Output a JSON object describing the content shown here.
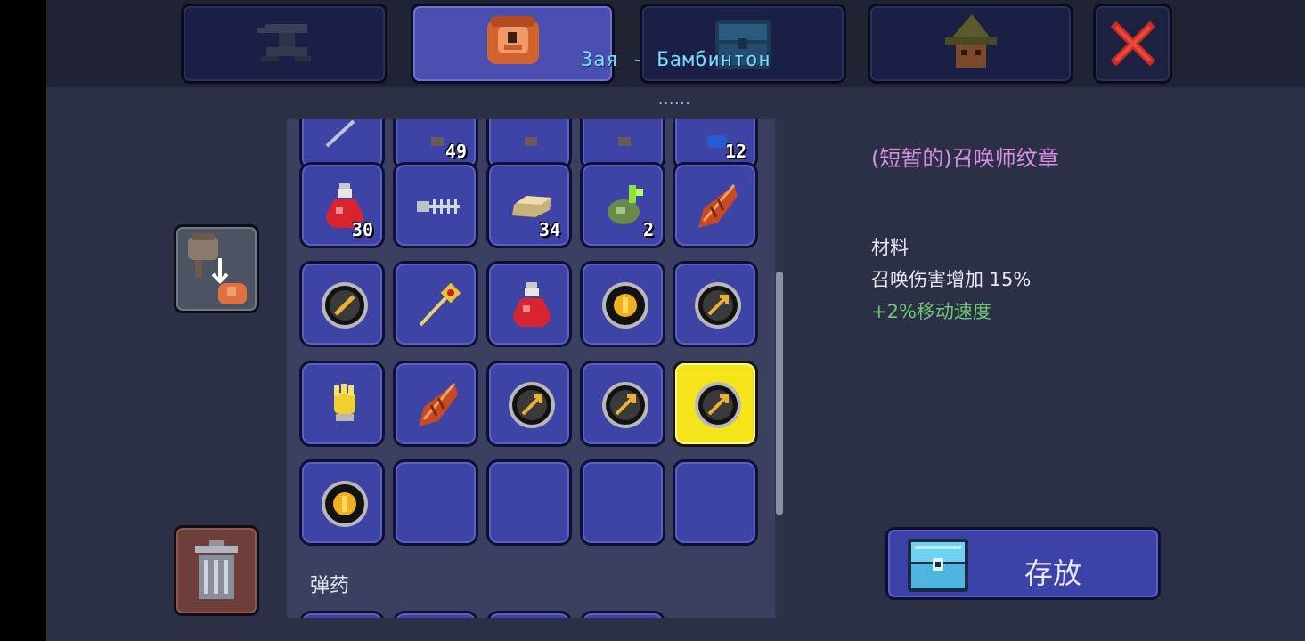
{
  "player_name": "Зая - Бамбинтон",
  "dots": "......",
  "tabs": [
    {
      "name": "crafting",
      "icon": "anvil-icon"
    },
    {
      "name": "inventory",
      "icon": "player-bag-icon",
      "active": true
    },
    {
      "name": "storage",
      "icon": "chest-icon"
    },
    {
      "name": "npc",
      "icon": "wizard-icon"
    },
    {
      "name": "close",
      "icon": "close-icon"
    }
  ],
  "inventory": {
    "row0": [
      {
        "icon": "sword-partial-icon",
        "count": ""
      },
      {
        "icon": "item-partial-icon",
        "count": "49"
      },
      {
        "icon": "item-partial-icon",
        "count": ""
      },
      {
        "icon": "item-partial-icon",
        "count": ""
      },
      {
        "icon": "blue-item-partial-icon",
        "count": "12"
      }
    ],
    "row1": [
      {
        "icon": "healing-potion-icon",
        "count": "30"
      },
      {
        "icon": "skeleton-fish-icon",
        "count": ""
      },
      {
        "icon": "gold-bar-icon",
        "count": "34"
      },
      {
        "icon": "green-moss-icon",
        "count": "2"
      },
      {
        "icon": "autumn-leaf-icon",
        "count": ""
      }
    ],
    "row2": [
      {
        "icon": "emblem-sword-icon",
        "count": ""
      },
      {
        "icon": "golden-staff-icon",
        "count": ""
      },
      {
        "icon": "healing-potion-icon",
        "count": ""
      },
      {
        "icon": "emblem-coin-icon",
        "count": ""
      },
      {
        "icon": "emblem-arrow-icon",
        "count": ""
      }
    ],
    "row3": [
      {
        "icon": "golden-glove-icon",
        "count": ""
      },
      {
        "icon": "autumn-leaf-icon",
        "count": ""
      },
      {
        "icon": "emblem-arrow-icon",
        "count": ""
      },
      {
        "icon": "emblem-arrow-icon",
        "count": ""
      },
      {
        "icon": "emblem-arrow-icon",
        "count": "",
        "selected": true
      }
    ],
    "row4": [
      {
        "icon": "emblem-coin-icon",
        "count": ""
      },
      {
        "icon": "",
        "count": ""
      },
      {
        "icon": "",
        "count": ""
      },
      {
        "icon": "",
        "count": ""
      },
      {
        "icon": "",
        "count": ""
      }
    ]
  },
  "ammo_label": "弹药",
  "tooltip": {
    "title": "(短暂的)召唤师纹章",
    "type": "材料",
    "stat": "召唤伤害增加 15%",
    "bonus": "+2%移动速度"
  },
  "deposit_button": {
    "label": "存放",
    "icon": "chest-icon"
  },
  "side_buttons": {
    "loot_all": "loot-all-icon",
    "trash": "trash-can-icon"
  },
  "colors": {
    "tooltip_title": "#d78fe2",
    "bonus": "#6fc772",
    "player_name": "#7fd8ff"
  }
}
